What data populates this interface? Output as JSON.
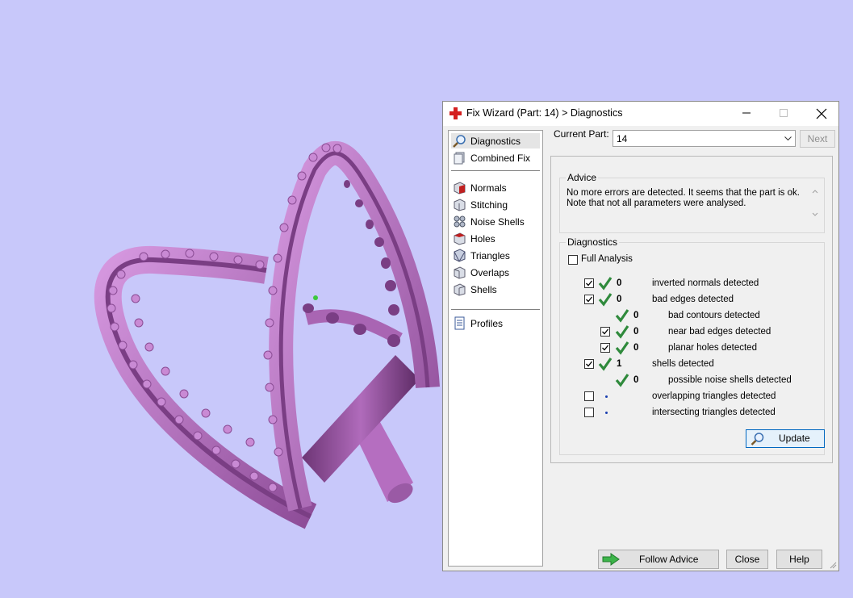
{
  "window": {
    "title": "Fix Wizard (Part: 14) > Diagnostics",
    "minimize_glyph": "–",
    "close_glyph": "✕"
  },
  "nav": {
    "items": [
      {
        "label": "Diagnostics",
        "icon": "magnifier-icon",
        "selected": true
      },
      {
        "label": "Combined Fix",
        "icon": "layers-icon"
      },
      {
        "label": "Normals",
        "icon": "normals-cube-icon"
      },
      {
        "label": "Stitching",
        "icon": "stitching-icon"
      },
      {
        "label": "Noise Shells",
        "icon": "noise-shells-icon"
      },
      {
        "label": "Holes",
        "icon": "holes-icon"
      },
      {
        "label": "Triangles",
        "icon": "triangles-icon"
      },
      {
        "label": "Overlaps",
        "icon": "overlaps-icon"
      },
      {
        "label": "Shells",
        "icon": "shells-icon"
      },
      {
        "label": "Profiles",
        "icon": "document-icon"
      }
    ]
  },
  "part": {
    "label": "Current Part:",
    "value": "14",
    "next_label": "Next"
  },
  "advice": {
    "title": "Advice",
    "text": "No more errors are detected. It seems that the part is ok. Note that not all parameters were analysed."
  },
  "diagnostics": {
    "title": "Diagnostics",
    "full_analysis_label": "Full Analysis",
    "full_analysis_checked": false,
    "rows": [
      {
        "checked": true,
        "status": "ok",
        "count": "0",
        "label": "inverted normals detected",
        "indent": 0
      },
      {
        "checked": true,
        "status": "ok",
        "count": "0",
        "label": "bad edges detected",
        "indent": 0
      },
      {
        "checked": null,
        "status": "ok",
        "count": "0",
        "label": "bad contours detected",
        "indent": 1
      },
      {
        "checked": true,
        "status": "ok",
        "count": "0",
        "label": "near bad edges detected",
        "indent": 1
      },
      {
        "checked": true,
        "status": "ok",
        "count": "0",
        "label": "planar holes detected",
        "indent": 1
      },
      {
        "checked": true,
        "status": "ok",
        "count": "1",
        "label": "shells detected",
        "indent": 0
      },
      {
        "checked": null,
        "status": "ok",
        "count": "0",
        "label": "possible noise shells detected",
        "indent": 1
      },
      {
        "checked": false,
        "status": "pending",
        "count": "",
        "label": "overlapping triangles detected",
        "indent": 0
      },
      {
        "checked": false,
        "status": "pending",
        "count": "",
        "label": "intersecting triangles detected",
        "indent": 0
      }
    ],
    "update_label": "Update"
  },
  "footer": {
    "follow_advice_label": "Follow Advice",
    "close_label": "Close",
    "help_label": "Help"
  },
  "colors": {
    "viewport_bg": "#c8c8fa",
    "model": "#c77fd0",
    "check_green": "#2f8a3c",
    "title_red": "#d42020"
  }
}
